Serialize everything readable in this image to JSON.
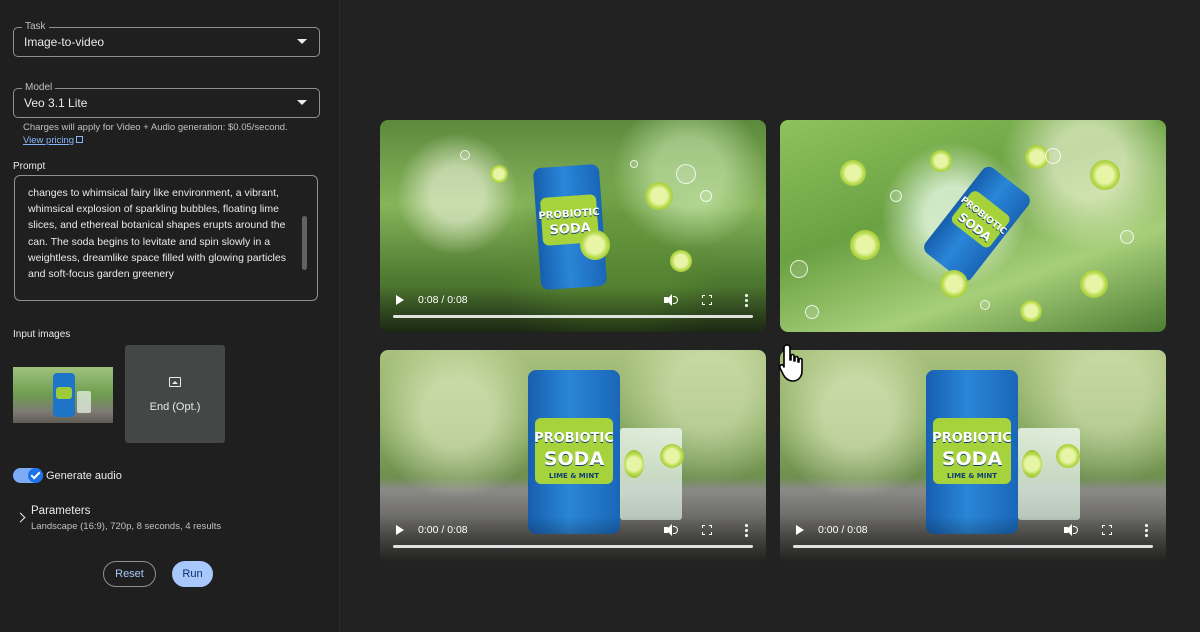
{
  "sidebar": {
    "task": {
      "legend": "Task",
      "value": "Image-to-video"
    },
    "model": {
      "legend": "Model",
      "value": "Veo 3.1 Lite"
    },
    "charges_note": "Charges will apply for Video + Audio generation: $0.05/second.",
    "pricing_link": "View pricing",
    "prompt_label": "Prompt",
    "prompt_text": "changes to whimsical fairy like environment, a vibrant, whimsical explosion of sparkling bubbles, floating lime slices, and ethereal botanical shapes erupts around the can. The soda begins to levitate and spin slowly in a weightless, dreamlike space filled with glowing particles and soft-focus garden greenery",
    "input_images_label": "Input images",
    "end_placeholder": "End (Opt.)",
    "generate_audio_label": "Generate audio",
    "generate_audio_on": true,
    "parameters_title": "Parameters",
    "parameters_summary": "Landscape (16:9), 720p, 8 seconds, 4 results",
    "reset_label": "Reset",
    "run_label": "Run"
  },
  "results": [
    {
      "time": "0:08 / 0:08",
      "scene": "fairy"
    },
    {
      "time": "",
      "scene": "fizz"
    },
    {
      "time": "0:00 / 0:08",
      "scene": "table"
    },
    {
      "time": "0:00 / 0:08",
      "scene": "table"
    }
  ],
  "can_label": {
    "line1": "PROBIOTIC",
    "line2": "SODA",
    "line3": "LIME & MINT"
  },
  "colors": {
    "accent": "#a8c7fa",
    "toggle": "#1a73e8",
    "link": "#8ab4f8"
  },
  "icons": {
    "dropdown": "caret-down-icon",
    "external": "external-link-icon",
    "image": "image-icon",
    "expand": "chevron-right-icon",
    "play": "play-icon",
    "volume": "volume-icon",
    "fullscreen": "fullscreen-icon",
    "more": "more-vert-icon",
    "cursor": "hand-pointer-icon"
  }
}
